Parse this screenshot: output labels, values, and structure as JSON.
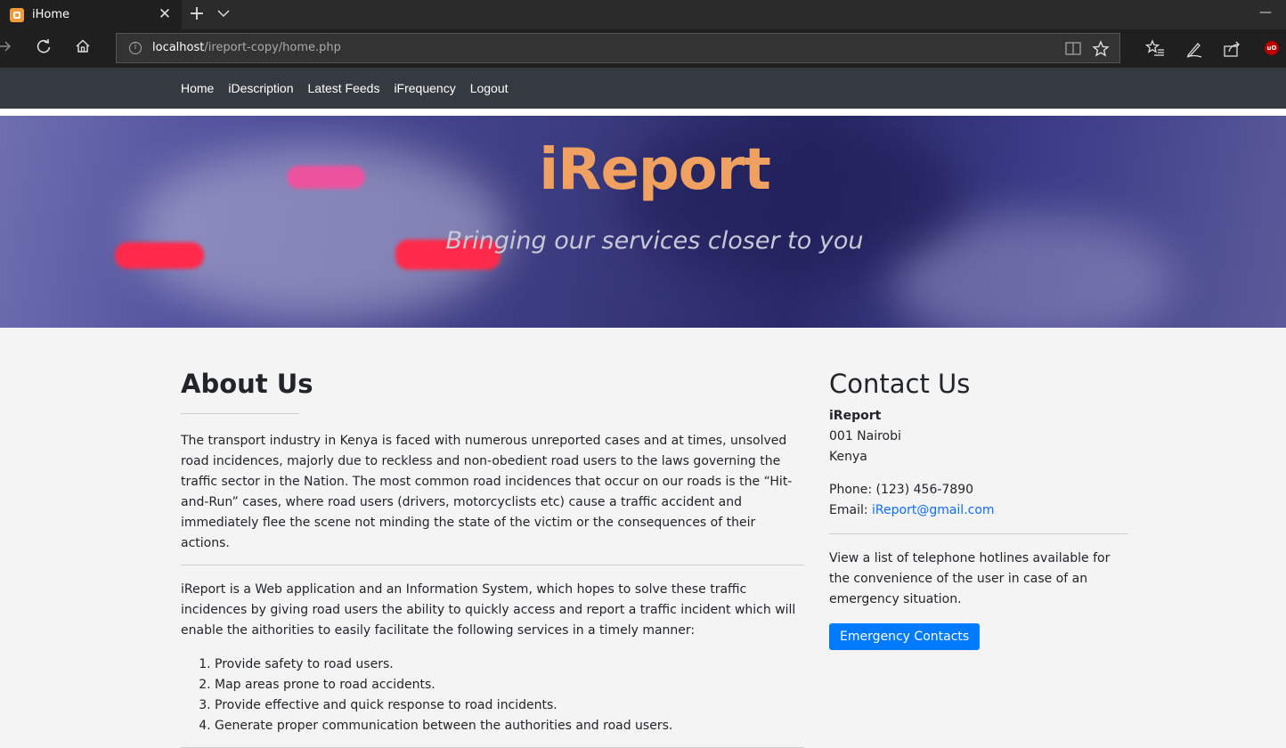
{
  "browser": {
    "tab_title": "iHome",
    "url_host": "localhost",
    "url_path": "/ireport-copy/home.php",
    "ext_badge": "uO"
  },
  "nav": {
    "links": [
      "Home",
      "iDescription",
      "Latest Feeds",
      "iFrequency",
      "Logout"
    ]
  },
  "hero": {
    "title": "iReport",
    "subtitle": "Bringing our services closer to you",
    "title_color": "#f0a060"
  },
  "about": {
    "heading": "About Us",
    "paragraph1": "The transport industry in Kenya is faced with numerous unreported cases and at times, unsolved road incidences, majorly due to reckless and non-obedient road users to the laws governing the traffic sector in the Nation. The most common road incidences that occur on our roads is the “Hit-and-Run” cases, where road users (drivers, motorcyclists etc) cause a traffic accident and immediately flee the scene not minding the state of the victim or the consequences of their actions.",
    "paragraph2": "iReport is a Web application and an Information System, which hopes to solve these traffic incidences by giving road users the ability to quickly access and report a traffic incident which will enable the aithorities to easily facilitate the following services in a timely manner:",
    "services": [
      "Provide safety to road users.",
      "Map areas prone to road accidents.",
      "Provide effective and quick response to road incidents.",
      "Generate proper communication between the authorities and road users."
    ]
  },
  "contact": {
    "heading": "Contact Us",
    "org": "iReport",
    "address_line1": "001 Nairobi",
    "address_line2": "Kenya",
    "phone_label": "Phone: (123) 456-7890",
    "email_label": "Email:",
    "email": "iReport@gmail.com",
    "note": "View a list of telephone hotlines available for the convenience of the user in case of an emergency situation.",
    "button_label": "Emergency Contacts",
    "accent_color": "#007bff"
  }
}
